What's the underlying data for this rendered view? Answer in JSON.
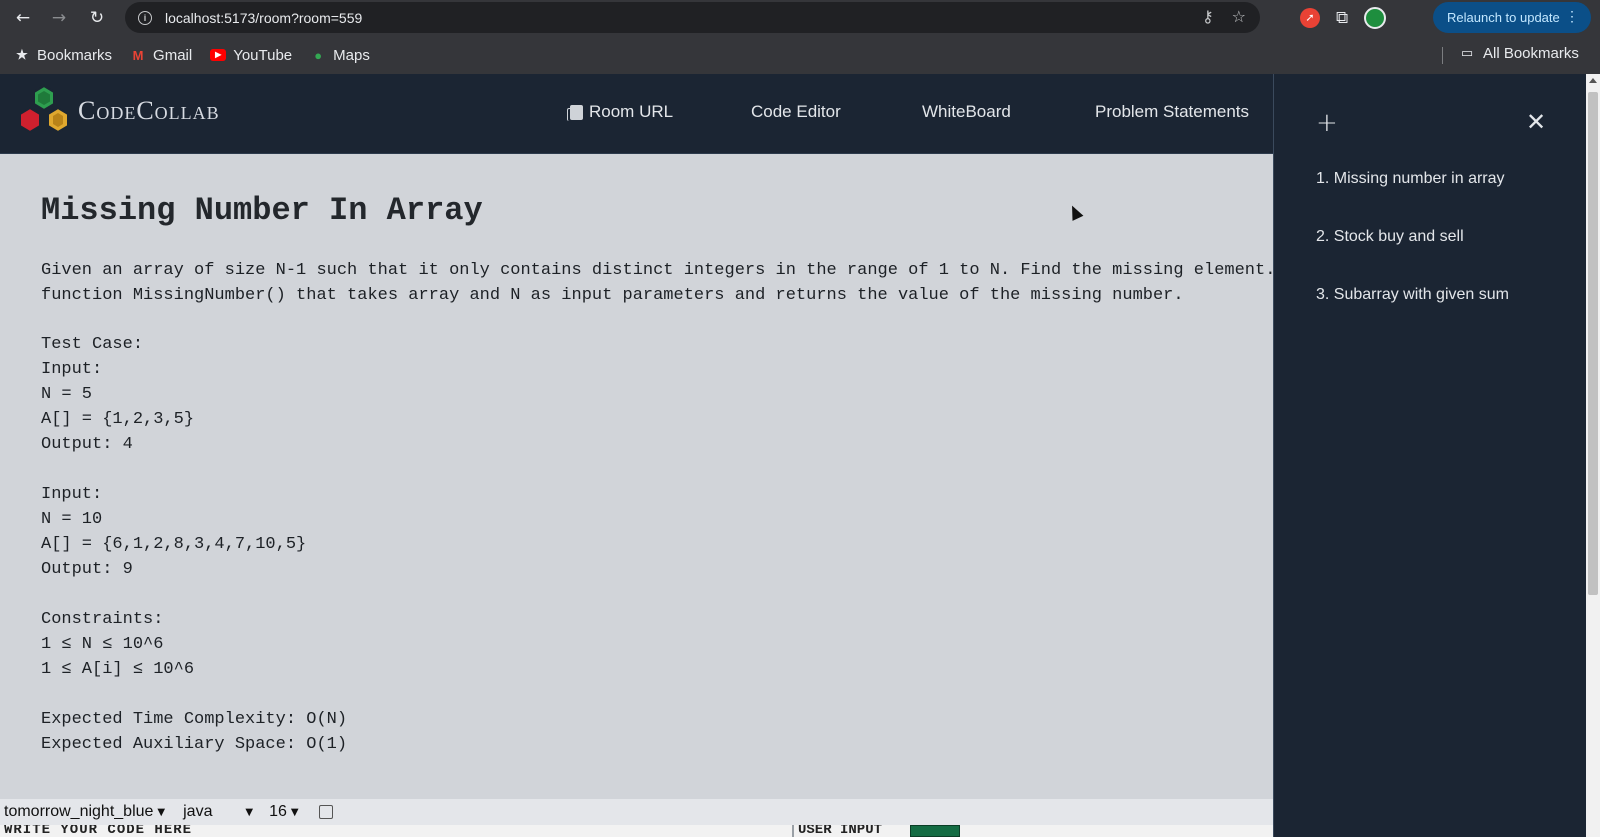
{
  "browser": {
    "url": "localhost:5173/room?room=559",
    "relaunch_label": "Relaunch to update",
    "bookmarks": [
      {
        "label": "Bookmarks",
        "icon": "star-icon"
      },
      {
        "label": "Gmail",
        "icon": "gmail-icon"
      },
      {
        "label": "YouTube",
        "icon": "youtube-icon"
      },
      {
        "label": "Maps",
        "icon": "maps-icon"
      }
    ],
    "all_bookmarks_label": "All Bookmarks"
  },
  "app": {
    "brand": "CodeCollab",
    "nav": {
      "room_url": "Room URL",
      "code_editor": "Code Editor",
      "whiteboard": "WhiteBoard",
      "problem_statements": "Problem Statements"
    }
  },
  "problem": {
    "title": "Missing Number In Array",
    "description_line1": "Given an array of size N-1 such that it only contains distinct integers in the range of 1 to N. Find the missing element. Y",
    "description_line2": "function MissingNumber() that takes array and N as input parameters and returns the value of the missing number.",
    "body_lines": [
      "Test Case:",
      "Input:",
      "N = 5",
      "A[] = {1,2,3,5}",
      "Output: 4",
      "",
      "Input:",
      "N = 10",
      "A[] = {6,1,2,8,3,4,7,10,5}",
      "Output: 9",
      "",
      "Constraints:",
      "1 ≤ N ≤ 10^6",
      "1 ≤ A[i] ≤ 10^6",
      "",
      "Expected Time Complexity: O(N)",
      "Expected Auxiliary Space: O(1)"
    ]
  },
  "toolbar": {
    "theme": "tomorrow_night_blue",
    "language": "java",
    "font_size": "16"
  },
  "editor": {
    "write_label": "WRITE YOUR CODE HERE",
    "user_input_label": "USER INPUT"
  },
  "side_panel": {
    "problems": [
      "1. Missing number in array",
      "2. Stock buy and sell",
      "3. Subarray with given sum"
    ]
  },
  "colors": {
    "app_bg": "#1b2533",
    "content_bg": "#d1d4d9",
    "relaunch_bg": "#0b4f88",
    "run_button": "#146c43"
  }
}
